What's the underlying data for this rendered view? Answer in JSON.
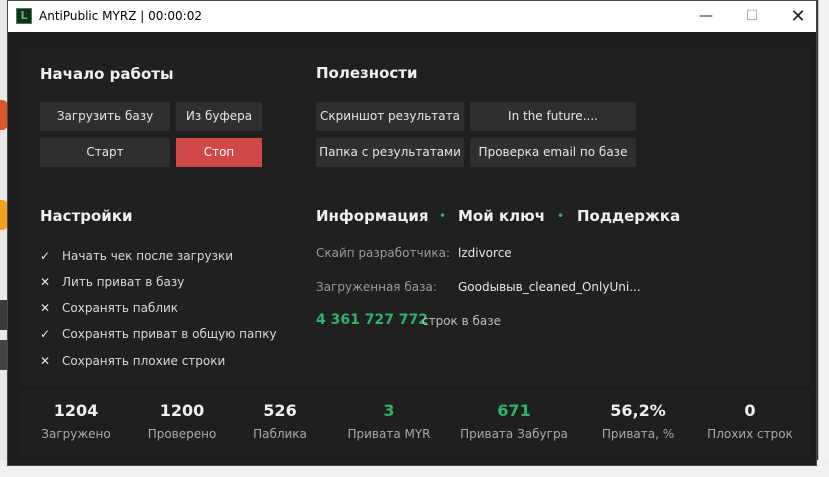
{
  "window": {
    "icon_letter": "L",
    "title": "AntiPublic MYRZ | 00:00:02",
    "minimize_glyph": "—",
    "maximize_glyph": "☐",
    "close_glyph": "✕"
  },
  "start_section": {
    "title": "Начало работы",
    "load_base": "Загрузить базу",
    "from_buffer": "Из буфера",
    "start": "Старт",
    "stop": "Стоп"
  },
  "utils_section": {
    "title": "Полезности",
    "screenshot": "Скриншот результата",
    "future": "In the future....",
    "results_folder": "Папка с результатами",
    "check_email": "Проверка email по базе"
  },
  "settings": {
    "title": "Настройки",
    "items": [
      {
        "label": "Начать чек после загрузки",
        "mark": "✓",
        "checked": true
      },
      {
        "label": "Лить приват в базу",
        "mark": "✕",
        "checked": false
      },
      {
        "label": "Сохранять паблик",
        "mark": "✕",
        "checked": false
      },
      {
        "label": "Сохранять приват в общую папку",
        "mark": "✓",
        "checked": true
      },
      {
        "label": "Сохранять плохие строки",
        "mark": "✕",
        "checked": false
      }
    ]
  },
  "info": {
    "tab_info": "Информация",
    "tab_key": "Мой ключ",
    "tab_support": "Поддержка",
    "separator": "•",
    "skype_label": "Скайп разработчика:",
    "skype_value": "lzdivorce",
    "base_label": "Загруженная база:",
    "base_value": "Goodывыв_cleaned_OnlyUni...",
    "rows_count": "4 361 727 772",
    "rows_suffix": "строк в базе"
  },
  "stats": [
    {
      "value": "1204",
      "label": "Загружено"
    },
    {
      "value": "1200",
      "label": "Проверено"
    },
    {
      "value": "526",
      "label": "Паблика"
    },
    {
      "value": "3",
      "label": "Привата MYR"
    },
    {
      "value": "671",
      "label": "Привата Забугра"
    },
    {
      "value": "56,2%",
      "label": "Привата, %"
    },
    {
      "value": "0",
      "label": "Плохих строк"
    }
  ],
  "colors": {
    "accent_green": "#2bb36a",
    "stop_red": "#d14848",
    "background": "#1c1c1c"
  }
}
